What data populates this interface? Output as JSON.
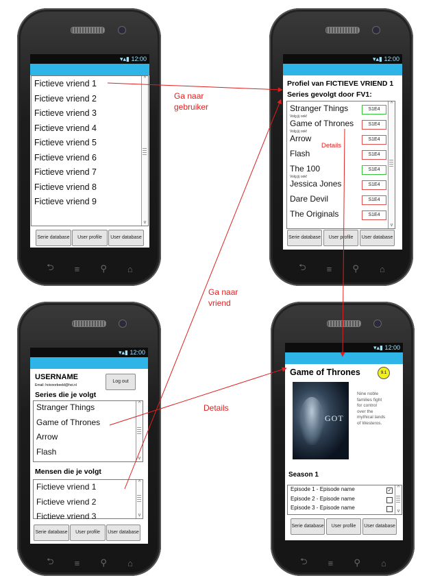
{
  "status_time": "12:00",
  "nav_buttons": [
    "Serie database",
    "User profile",
    "User database"
  ],
  "screen1": {
    "friends": [
      "Fictieve vriend 1",
      "Fictieve vriend 2",
      "Fictieve vriend 3",
      "Fictieve vriend 4",
      "Fictieve vriend 5",
      "Fictieve vriend 6",
      "Fictieve vriend 7",
      "Fictieve vriend 8",
      "Fictieve vriend 9"
    ]
  },
  "screen2": {
    "title": "Profiel van FICTIEVE VRIEND 1",
    "subtitle": "Series gevolgt door FV1:",
    "series": [
      {
        "name": "Stranger Things",
        "ep": "S1E4",
        "status": "green",
        "note": "Volg jij ook!"
      },
      {
        "name": "Game of Thrones",
        "ep": "S1E4",
        "status": "red",
        "note": "Volg jij ook!"
      },
      {
        "name": "Arrow",
        "ep": "S1E4",
        "status": "red",
        "note": ""
      },
      {
        "name": "Flash",
        "ep": "S1E4",
        "status": "red",
        "note": ""
      },
      {
        "name": "The 100",
        "ep": "S1E4",
        "status": "green",
        "note": "Volg jij ook!"
      },
      {
        "name": "Jessica Jones",
        "ep": "S1E4",
        "status": "red",
        "note": ""
      },
      {
        "name": "Dare Devil",
        "ep": "S1E4",
        "status": "red",
        "note": ""
      },
      {
        "name": "The Originals",
        "ep": "S1E4",
        "status": "red",
        "note": ""
      }
    ]
  },
  "screen3": {
    "username": "USERNAME",
    "email": "Email: hoivoorbeeld@hoi.nl",
    "logout": "Log out",
    "series_heading": "Series die je volgt",
    "series": [
      "Stranger Things",
      "Game of Thrones",
      "Arrow",
      "Flash"
    ],
    "people_heading": "Mensen die je volgt",
    "people": [
      "Fictieve vriend 1",
      "Fictieve vriend 2",
      "Fictieve vriend 3"
    ]
  },
  "screen4": {
    "title": "Game of Thrones",
    "rating": "9.1",
    "poster_text": "GOT",
    "description": "Nine noble families fight for control over the mythical lands of Westeros.",
    "season": "Season 1",
    "episodes": [
      {
        "name": "Episode 1 - Episode name",
        "checked": true
      },
      {
        "name": "Episode 2 - Episode name",
        "checked": false
      },
      {
        "name": "Episode 3 - Episode name",
        "checked": false
      }
    ]
  },
  "annotations": {
    "go_user": [
      "Ga naar",
      "gebruiker"
    ],
    "go_friend": [
      "Ga naar",
      "vriend"
    ],
    "details_small": "Details",
    "details_big": "Details"
  }
}
